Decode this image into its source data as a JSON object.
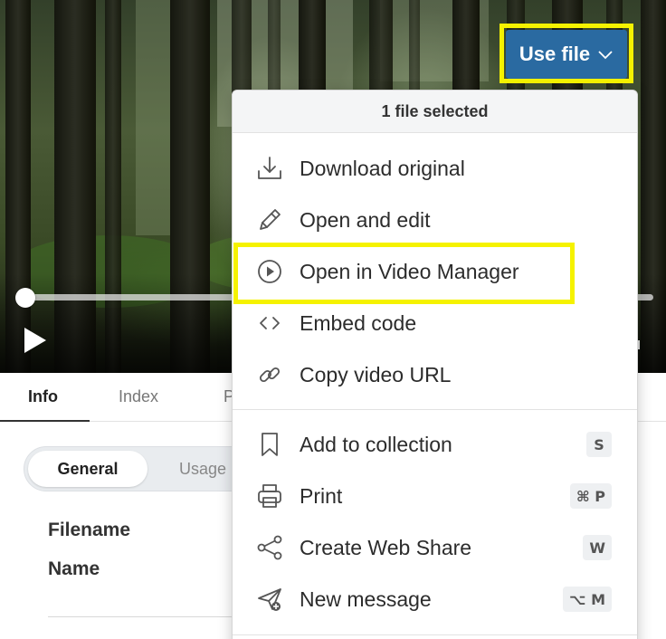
{
  "player": {
    "state": "paused",
    "progress": 0,
    "icons": {
      "play": "play-icon"
    }
  },
  "use_file": {
    "label": "Use file",
    "icon": "chevron-down-icon",
    "color": "#2a6aa1",
    "highlight_color": "#f5f200"
  },
  "menu": {
    "header": "1 file selected",
    "items": [
      {
        "label": "Download original",
        "icon": "download-icon"
      },
      {
        "label": "Open and edit",
        "icon": "pencil-icon"
      },
      {
        "label": "Open in Video Manager",
        "icon": "play-circle-icon",
        "highlighted": true
      },
      {
        "label": "Embed code",
        "icon": "code-icon"
      },
      {
        "label": "Copy video URL",
        "icon": "link-icon"
      }
    ],
    "items2": [
      {
        "label": "Add to collection",
        "icon": "bookmark-icon",
        "shortcut": "S"
      },
      {
        "label": "Print",
        "icon": "printer-icon",
        "shortcut": "⌘ P"
      },
      {
        "label": "Create Web Share",
        "icon": "share-icon",
        "shortcut": "W"
      },
      {
        "label": "New message",
        "icon": "send-icon",
        "shortcut": "⌥ M"
      }
    ]
  },
  "tabs": [
    {
      "label": "Info",
      "active": true
    },
    {
      "label": "Index",
      "active": false
    },
    {
      "label": "P",
      "active": false
    }
  ],
  "info": {
    "segments": [
      {
        "label": "General",
        "active": true
      },
      {
        "label": "Usage",
        "active": false
      }
    ],
    "fields": [
      {
        "label": "Filename"
      },
      {
        "label": "Name"
      }
    ]
  }
}
